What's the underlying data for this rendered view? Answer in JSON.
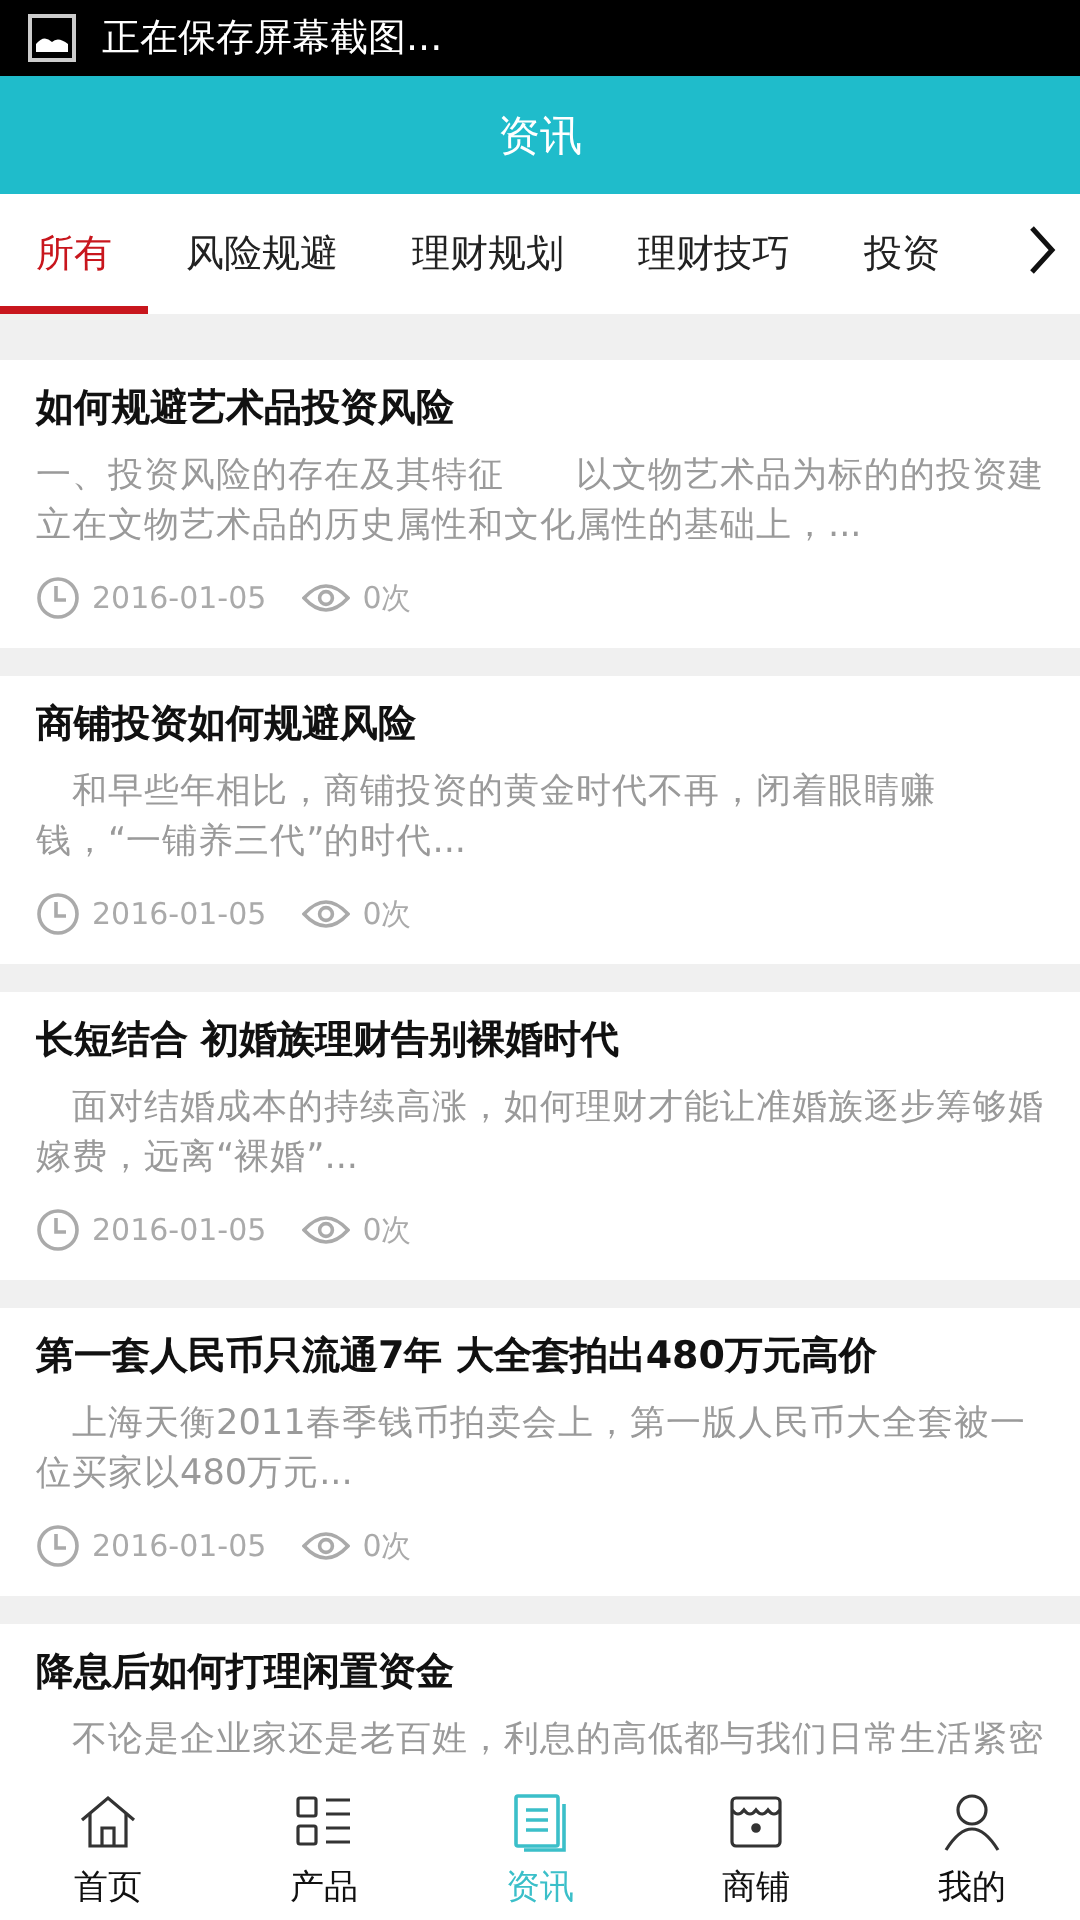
{
  "status_bar": {
    "notification": "正在保存屏幕截图..."
  },
  "header": {
    "title": "资讯"
  },
  "tabs": [
    {
      "label": "所有",
      "selected": true
    },
    {
      "label": "风险规避",
      "selected": false
    },
    {
      "label": "理财规划",
      "selected": false
    },
    {
      "label": "理财技巧",
      "selected": false
    },
    {
      "label": "投资",
      "selected": false
    }
  ],
  "articles": [
    {
      "title": "如何规避艺术品投资风险",
      "summary": "一、投资风险的存在及其特征　　以文物艺术品为标的的投资建立在文物艺术品的历史属性和文化属性的基础上，...",
      "date": "2016-01-05",
      "views": "0次"
    },
    {
      "title": "商铺投资如何规避风险",
      "summary": "　和早些年相比，商铺投资的黄金时代不再，闭着眼睛赚钱，“一铺养三代”的时代...",
      "date": "2016-01-05",
      "views": "0次"
    },
    {
      "title": "长短结合 初婚族理财告别裸婚时代",
      "summary": "　面对结婚成本的持续高涨，如何理财才能让准婚族逐步筹够婚嫁费，远离“裸婚”...",
      "date": "2016-01-05",
      "views": "0次"
    },
    {
      "title": "第一套人民币只流通7年 大全套拍出480万元高价",
      "summary": "　上海天衡2011春季钱币拍卖会上，第一版人民币大全套被一位买家以480万元...",
      "date": "2016-01-05",
      "views": "0次"
    },
    {
      "title": "降息后如何打理闲置资金",
      "summary": "　不论是企业家还是老百姓，利息的高低都与我们日常生活紧密"
    }
  ],
  "nav": [
    {
      "label": "首页",
      "kind": "home",
      "selected": false
    },
    {
      "label": "产品",
      "kind": "products",
      "selected": false
    },
    {
      "label": "资讯",
      "kind": "news",
      "selected": true
    },
    {
      "label": "商铺",
      "kind": "shop",
      "selected": false
    },
    {
      "label": "我的",
      "kind": "profile",
      "selected": false
    }
  ]
}
